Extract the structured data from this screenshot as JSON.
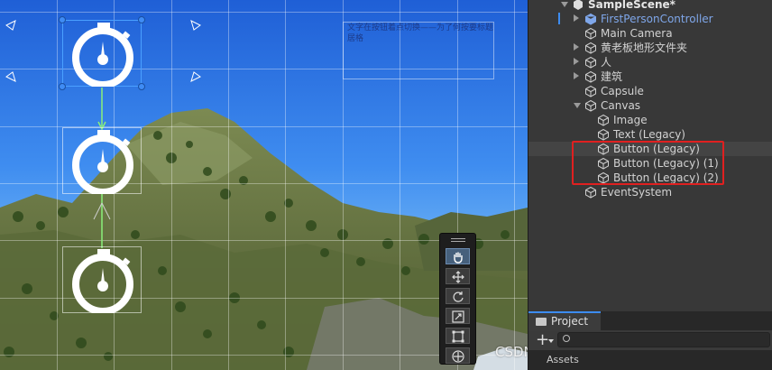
{
  "scene_view": {
    "text_object_content": "文字在按钮着点切换——为了何按要标题居格",
    "tools": [
      {
        "name": "hand-tool",
        "active": true
      },
      {
        "name": "move-tool",
        "active": false
      },
      {
        "name": "rotate-tool",
        "active": false
      },
      {
        "name": "scale-tool",
        "active": false
      },
      {
        "name": "rect-tool",
        "active": false
      },
      {
        "name": "transform-tool",
        "active": false
      }
    ]
  },
  "hierarchy": {
    "scene_name": "SampleScene*",
    "items": [
      {
        "label": "FirstPersonController",
        "indent": 1,
        "expand": "right",
        "prefab": true,
        "selected": false
      },
      {
        "label": "Main Camera",
        "indent": 1,
        "expand": "none",
        "prefab": false,
        "selected": false
      },
      {
        "label": "黄老板地形文件夹",
        "indent": 1,
        "expand": "right",
        "prefab": false,
        "selected": false
      },
      {
        "label": "人",
        "indent": 1,
        "expand": "right",
        "prefab": false,
        "selected": false
      },
      {
        "label": "建筑",
        "indent": 1,
        "expand": "right",
        "prefab": false,
        "selected": false
      },
      {
        "label": "Capsule",
        "indent": 1,
        "expand": "none",
        "prefab": false,
        "selected": false
      },
      {
        "label": "Canvas",
        "indent": 1,
        "expand": "down",
        "prefab": false,
        "selected": false
      },
      {
        "label": "Image",
        "indent": 2,
        "expand": "none",
        "prefab": false,
        "selected": false
      },
      {
        "label": "Text (Legacy)",
        "indent": 2,
        "expand": "none",
        "prefab": false,
        "selected": false
      },
      {
        "label": "Button (Legacy)",
        "indent": 2,
        "expand": "none",
        "prefab": false,
        "selected": true
      },
      {
        "label": "Button (Legacy) (1)",
        "indent": 2,
        "expand": "none",
        "prefab": false,
        "selected": false
      },
      {
        "label": "Button (Legacy) (2)",
        "indent": 2,
        "expand": "none",
        "prefab": false,
        "selected": false
      },
      {
        "label": "EventSystem",
        "indent": 1,
        "expand": "none",
        "prefab": false,
        "selected": false
      }
    ]
  },
  "project": {
    "tab_label": "Project",
    "assets_label": "Assets",
    "search_placeholder": ""
  },
  "watermark": "CSDN @我的巨剑能轻松搅动潮汐",
  "colors": {
    "selection_outline": "#e02020",
    "prefab_text": "#7fa7ea",
    "accent": "#3d8cf0"
  }
}
